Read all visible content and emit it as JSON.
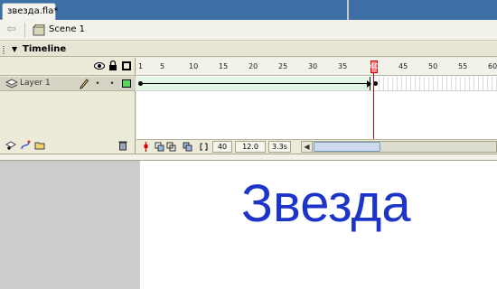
{
  "document": {
    "tab_title": "звезда.fla*"
  },
  "edit_bar": {
    "scene_label": "Scene 1"
  },
  "timeline": {
    "panel_title": "Timeline",
    "layer_header_icons": [
      "eye-icon",
      "lock-icon",
      "outline-icon"
    ],
    "layers": [
      {
        "name": "Layer 1",
        "outline_color": "#59d65c"
      }
    ],
    "ruler_numbers": [
      "1",
      "5",
      "10",
      "15",
      "20",
      "25",
      "30",
      "35",
      "40",
      "45",
      "50",
      "55",
      "60"
    ],
    "current_frame": "40",
    "frame_rate": "12.0 fps",
    "elapsed_time": "3.3s",
    "tween_color": "#e3f6e3",
    "playhead_color": "#cc0000"
  },
  "stage": {
    "text": "Звезда",
    "text_color": "#1c35c8",
    "background": "#ffffff",
    "pasteboard": "#cccccc"
  }
}
